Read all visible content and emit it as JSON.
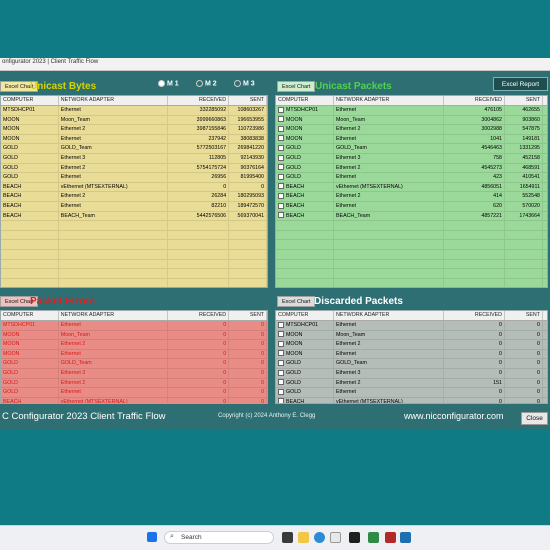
{
  "window": {
    "title": "onfigurator 2023 | Client Traffic Flow"
  },
  "toolbar": {
    "radios": [
      "M 1",
      "M 2",
      "M 3"
    ],
    "excel_report": "Excel Report"
  },
  "columns": {
    "computer": "COMPUTER",
    "adapter": "NETWORK ADAPTER",
    "received": "RECEIVED",
    "sent": "SENT"
  },
  "panels": {
    "unicast": {
      "button": "Excel Chart",
      "title": "Unicast Bytes",
      "title_color": "#d4d400",
      "rows": [
        [
          "MTSDHCP01",
          "Ethernet",
          "332285092",
          "108603267"
        ],
        [
          "MOON",
          "Moon_Team",
          "3999660863",
          "196653955"
        ],
        [
          "MOON",
          "Ethernet 2",
          "3987155846",
          "110723986"
        ],
        [
          "MOON",
          "Ethernet",
          "237942",
          "38083838"
        ],
        [
          "GOLD",
          "GOLD_Team",
          "5772503167",
          "269841220"
        ],
        [
          "GOLD",
          "Ethernet 3",
          "112805",
          "92143930"
        ],
        [
          "GOLD",
          "Ethernet 2",
          "5754175724",
          "90376164"
        ],
        [
          "GOLD",
          "Ethernet",
          "26956",
          "81995400"
        ],
        [
          "BEACH",
          "vEthernet (MTSEXTERNAL)",
          "0",
          "0"
        ],
        [
          "BEACH",
          "Ethernet 2",
          "26284",
          "180295093"
        ],
        [
          "BEACH",
          "Ethernet",
          "82210",
          "189472570"
        ],
        [
          "BEACH",
          "BEACH_Team",
          "5442576506",
          "569370041"
        ]
      ]
    },
    "unicast_packets": {
      "button": "Excel Chart",
      "title": "Unicast Packets",
      "title_color": "#4fd24f",
      "rows": [
        [
          "MTSDHCP01",
          "Ethernet",
          "476105",
          "462655"
        ],
        [
          "MOON",
          "Moon_Team",
          "3004862",
          "903860"
        ],
        [
          "MOON",
          "Ethernet 2",
          "3002988",
          "547875"
        ],
        [
          "MOON",
          "Ethernet",
          "1041",
          "149181"
        ],
        [
          "GOLD",
          "GOLD_Team",
          "4546463",
          "1331295"
        ],
        [
          "GOLD",
          "Ethernet 3",
          "758",
          "452158"
        ],
        [
          "GOLD",
          "Ethernet 2",
          "4545273",
          "468591"
        ],
        [
          "GOLD",
          "Ethernet",
          "423",
          "410541"
        ],
        [
          "BEACH",
          "vEthernet (MTSEXTERNAL)",
          "4856051",
          "1654911"
        ],
        [
          "BEACH",
          "Ethernet 2",
          "414",
          "552548"
        ],
        [
          "BEACH",
          "Ethernet",
          "620",
          "570020"
        ],
        [
          "BEACH",
          "BEACH_Team",
          "4857221",
          "1743664"
        ]
      ]
    },
    "errors": {
      "button": "Excel Chart",
      "title": "Packet Errors",
      "title_color": "#e02020",
      "rows": [
        [
          "MTSDHCP01",
          "Ethernet",
          "0",
          "0"
        ],
        [
          "MOON",
          "Moon_Team",
          "0",
          "0"
        ],
        [
          "MOON",
          "Ethernet 2",
          "0",
          "0"
        ],
        [
          "MOON",
          "Ethernet",
          "0",
          "0"
        ],
        [
          "GOLD",
          "GOLD_Team",
          "0",
          "0"
        ],
        [
          "GOLD",
          "Ethernet 3",
          "0",
          "0"
        ],
        [
          "GOLD",
          "Ethernet 2",
          "0",
          "0"
        ],
        [
          "GOLD",
          "Ethernet",
          "0",
          "0"
        ],
        [
          "BEACH",
          "vEthernet (MTSEXTERNAL)",
          "0",
          "0"
        ],
        [
          "BEACH",
          "Ethernet 2",
          "0",
          "0"
        ]
      ]
    },
    "discarded": {
      "button": "Excel Chart",
      "title": "Discarded Packets",
      "title_color": "#ffffff",
      "rows": [
        [
          "MTSDHCP01",
          "Ethernet",
          "0",
          "0"
        ],
        [
          "MOON",
          "Moon_Team",
          "0",
          "0"
        ],
        [
          "MOON",
          "Ethernet 2",
          "0",
          "0"
        ],
        [
          "MOON",
          "Ethernet",
          "0",
          "0"
        ],
        [
          "GOLD",
          "GOLD_Team",
          "0",
          "0"
        ],
        [
          "GOLD",
          "Ethernet 3",
          "0",
          "0"
        ],
        [
          "GOLD",
          "Ethernet 2",
          "151",
          "0"
        ],
        [
          "GOLD",
          "Ethernet",
          "0",
          "0"
        ],
        [
          "BEACH",
          "vEthernet (MTSEXTERNAL)",
          "0",
          "0"
        ],
        [
          "BEACH",
          "Ethernet 2",
          "0",
          "0"
        ]
      ]
    }
  },
  "footer": {
    "app_name": "C Configurator 2023 Client Traffic Flow",
    "copyright": "Copyright (c) 2024 Anthony E. Clegg",
    "website": "www.nicconfigurator.com",
    "close": "Close"
  },
  "taskbar": {
    "search": "Search"
  },
  "colors": {
    "unicast_bg": "#e8dc96",
    "packets_bg": "#9bd99b",
    "errors_bg": "#e98c86",
    "discarded_bg": "#b5bdb8",
    "errors_text": "#d41a1a"
  }
}
